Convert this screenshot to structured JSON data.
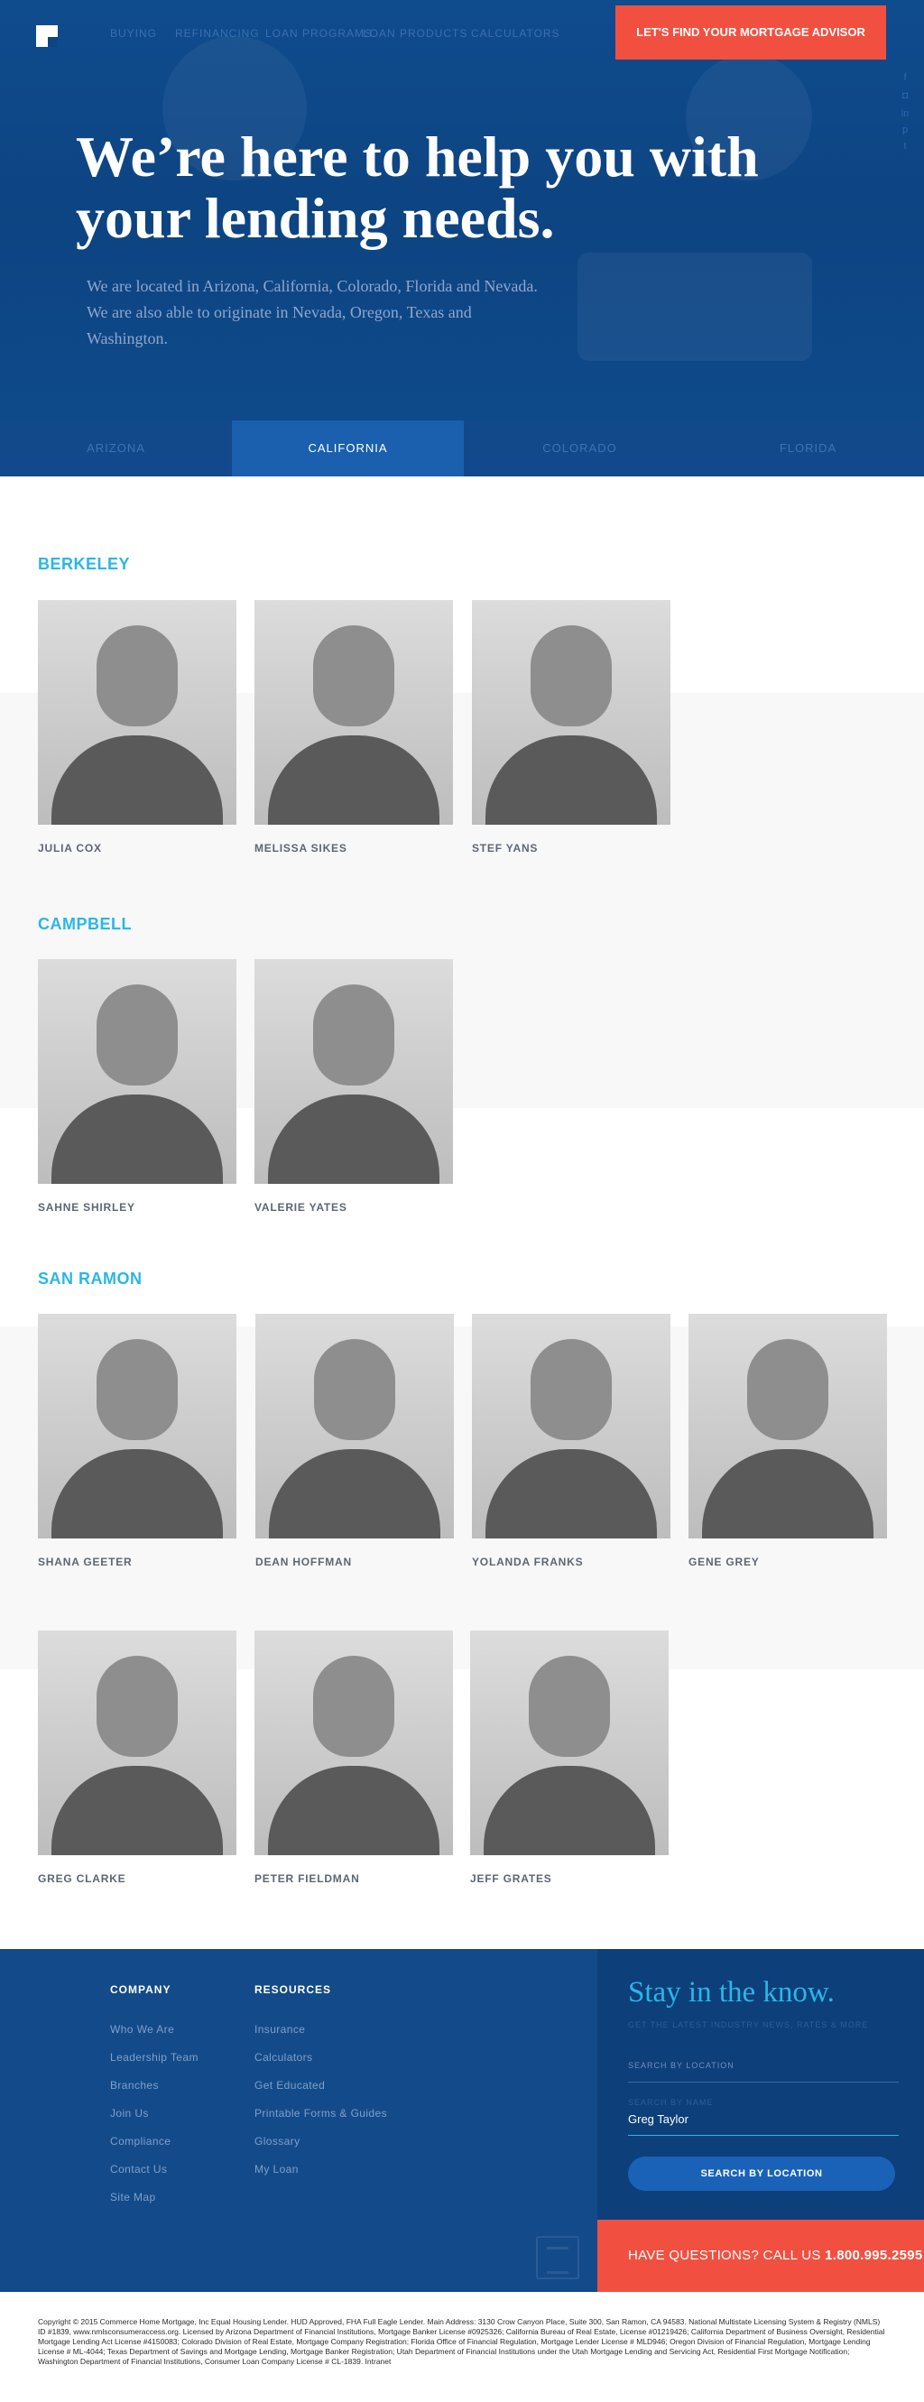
{
  "nav": {
    "items": [
      "Buying",
      "Refinancing",
      "Loan Programs",
      "Loan Products",
      "Calculators"
    ],
    "cta": "LET'S FIND YOUR MORTGAGE ADVISOR",
    "social_icons": [
      "facebook-icon",
      "instagram-icon",
      "linkedin-icon",
      "twitter-icon"
    ]
  },
  "hero": {
    "title": "We’re here to help you with your lending needs.",
    "subtitle": "We are located in Arizona, California, Colorado, Florida and Nevada. We are also able to originate in Nevada, Oregon, Texas and Washington."
  },
  "tabs": [
    {
      "label": "ARIZONA",
      "active": false
    },
    {
      "label": "CALIFORNIA",
      "active": true
    },
    {
      "label": "COLORADO",
      "active": false
    },
    {
      "label": "FLORIDA",
      "active": false
    }
  ],
  "locations": [
    {
      "city": "BERKELEY",
      "people": [
        "JULIA COX",
        "MELISSA SIKES",
        "STEF YANS"
      ]
    },
    {
      "city": "CAMPBELL",
      "people": [
        "SAHNE SHIRLEY",
        "VALERIE YATES"
      ]
    },
    {
      "city": "SAN RAMON",
      "people": [
        "SHANA GEETER",
        "DEAN HOFFMAN",
        "YOLANDA FRANKS",
        "GENE GREY",
        "GREG CLARKE",
        "PETER FIELDMAN",
        "JEFF GRATES"
      ]
    }
  ],
  "footer": {
    "company": {
      "title": "COMPANY",
      "links": [
        "Who We Are",
        "Leadership Team",
        "Branches",
        "Join Us",
        "Compliance",
        "Contact Us",
        "Site Map"
      ]
    },
    "resources": {
      "title": "RESOURCES",
      "links": [
        "Insurance",
        "Calculators",
        "Get Educated",
        "Printable Forms & Guides",
        "Glossary",
        "My Loan"
      ]
    },
    "stay": {
      "title": "Stay in the know.",
      "tagline": "GET THE LATEST INDUSTRY NEWS, RATES & MORE",
      "location_label": "SEARCH BY LOCATION",
      "name_label": "SEARCH BY NAME",
      "name_value": "Greg Taylor",
      "button": "SEARCH BY LOCATION"
    },
    "phone_prefix": "HAVE QUESTIONS? CALL US",
    "phone_number": "1.800.995.2595"
  },
  "legal": "Copyright © 2015 Commerce Home Mortgage, Inc Equal Housing Lender. HUD Approved, FHA Full Eagle Lender. Main Address: 3130 Crow Canyon Place, Suite 300, San Ramon, CA 94583. National Multistate Licensing System & Registry (NMLS) ID #1839, www.nmlsconsumeraccess.org. Licensed by Arizona Department of Financial Institutions, Mortgage Banker License #0925326; California Bureau of Real Estate, License #01219426; California Department of Business Oversight, Residential Mortgage Lending Act License #4150083; Colorado Division of Real Estate, Mortgage Company Registration; Florida Office of Financial Regulation, Mortgage Lender License # MLD946; Oregon Division of Financial Regulation, Mortgage Lending License # ML-4044; Texas Department of Savings and Mortgage Lending, Mortgage Banker Registration; Utah Department of Financial Institutions under the Utah Mortgage Lending and Servicing Act, Residential First Mortgage Notification; Washington Department of Financial Institutions, Consumer Loan Company License # CL-1839. Intranet"
}
